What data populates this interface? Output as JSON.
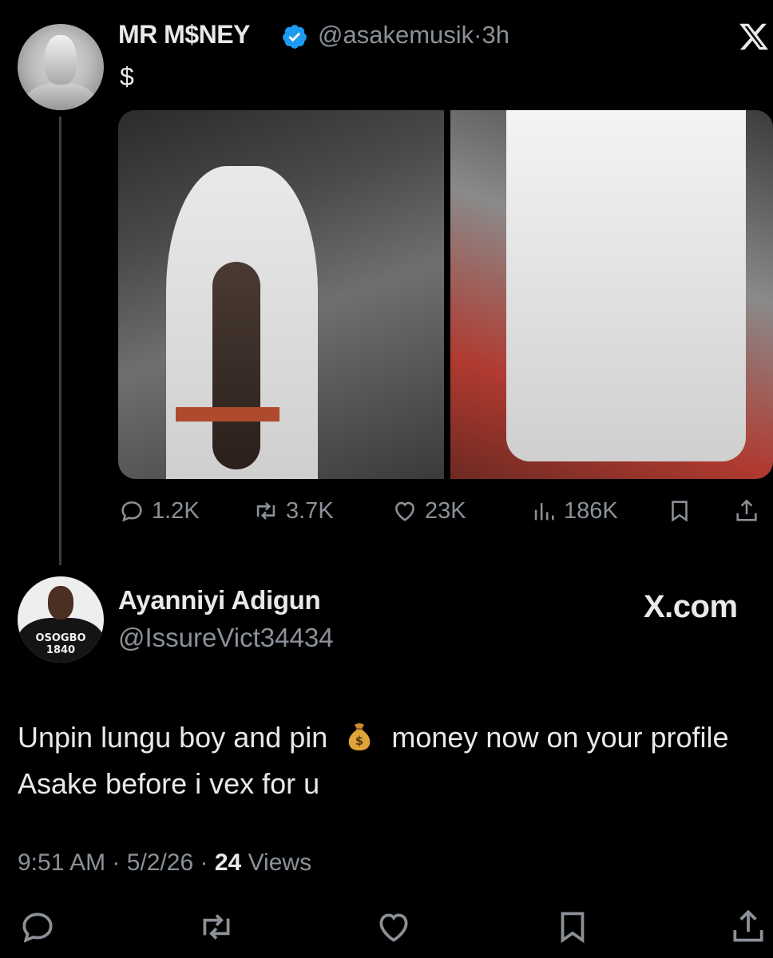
{
  "tweet": {
    "author_name": "MR M$NEY",
    "author_handle": "@asakemusik",
    "time_sep": "·",
    "time": "3h",
    "text": "$",
    "stats": {
      "replies": "1.2K",
      "reposts": "3.7K",
      "likes": "23K",
      "views": "186K"
    }
  },
  "reply": {
    "author_name": "Ayanniyi Adigun",
    "author_handle": "@IssureVict34434",
    "avatar_shirt_text": "OSOGBO\n1840",
    "text_before_emoji": "Unpin lungu boy and pin",
    "text_after_emoji": "money now on your profile Asake before i vex for u",
    "time": "9:51 AM",
    "date": "5/2/26",
    "views_count": "24",
    "views_label": "Views",
    "sep": "·"
  },
  "branding": {
    "watermark": "X.com"
  },
  "icons": {
    "verified": "verified-badge-icon",
    "x": "x-logo-icon",
    "emoji": "money-bag-icon"
  },
  "colors": {
    "background": "#000000",
    "text": "#e7e9ea",
    "muted": "#8b9197",
    "verified": "#1d9bf0"
  }
}
